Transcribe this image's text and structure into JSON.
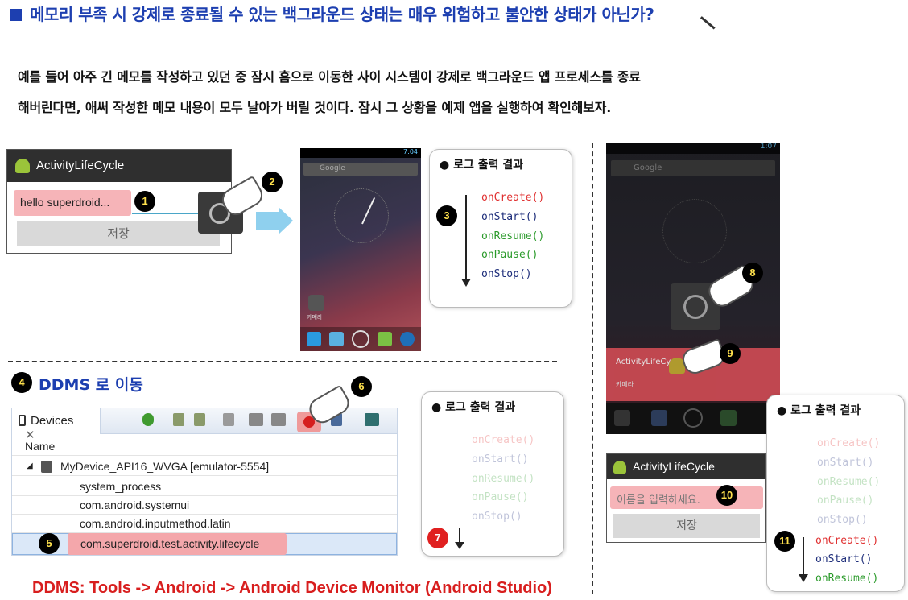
{
  "title": "메모리 부족 시 강제로 종료될 수 있는 백그라운드 상태는 매우 위험하고 불안한 상태가 아닌가?",
  "paragraph": [
    "예를 들어 아주 긴 메모를 작성하고 있던 중 잠시 홈으로 이동한 사이 시스템이 강제로 백그라운드 앱 프로세스를 종료",
    "해버린다면, 애써 작성한 메모 내용이 모두 날아가 버릴 것이다. 잠시 그 상황을 예제 앱을 실행하여 확인해보자."
  ],
  "app1": {
    "title": "ActivityLifeCycle",
    "input_value": "hello superdroid...",
    "save_label": "저장"
  },
  "home_phone": {
    "time": "7:04",
    "search": "Google",
    "camera_label": "카메라"
  },
  "log_title": "로그 출력 결과",
  "log1": [
    "onCreate()",
    "onStart()",
    "onResume()",
    "onPause()",
    "onStop()"
  ],
  "log2": [
    "onCreate()",
    "onStart()",
    "onResume()",
    "onPause()",
    "onStop()"
  ],
  "log3_faded": [
    "onCreate()",
    "onStart()",
    "onResume()",
    "onPause()",
    "onStop()"
  ],
  "log3_active": [
    "onCreate()",
    "onStart()",
    "onResume()"
  ],
  "ddms_heading": "DDMS 로 이동",
  "devices": {
    "tab_label": "Devices",
    "column": "Name",
    "device": "MyDevice_API16_WVGA [emulator-5554]",
    "processes": [
      "system_process",
      "com.android.systemui",
      "com.android.inputmethod.latin",
      "com.superdroid.test.activity.lifecycle"
    ]
  },
  "recent_phone": {
    "time": "1:07",
    "search": "Google",
    "recent_label": "ActivityLifeCy",
    "sub_label": "카메라"
  },
  "app2": {
    "title": "ActivityLifeCycle",
    "placeholder": "이름을 입력하세요.",
    "save_label": "저장"
  },
  "ddms_footer": "DDMS: Tools -> Android -> Android Device Monitor (Android Studio)",
  "steps": [
    "1",
    "2",
    "3",
    "4",
    "5",
    "6",
    "7",
    "8",
    "9",
    "10",
    "11"
  ],
  "colors": {
    "title": "#1d3fb0",
    "footer": "#d81e1e",
    "log_red": "#e03030",
    "log_navy": "#1d2d7a",
    "log_green": "#2a9a2a"
  }
}
